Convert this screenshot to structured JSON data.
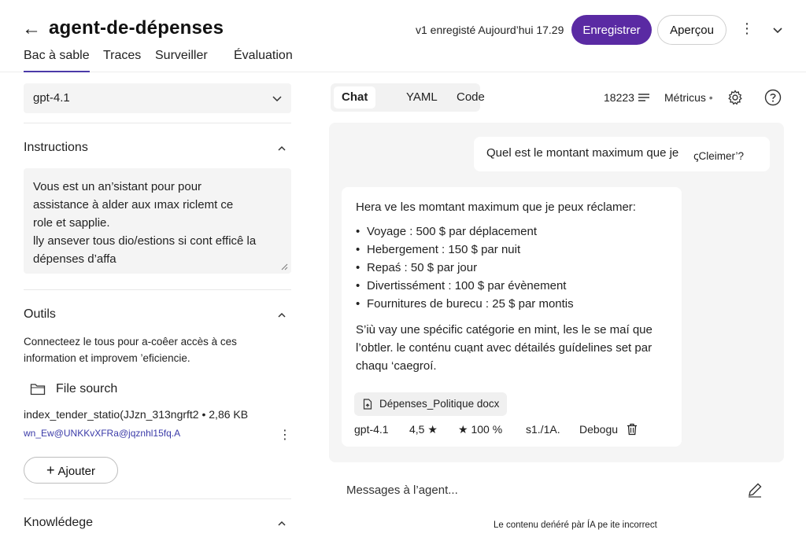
{
  "header": {
    "back_icon": "arrow-left-icon",
    "title": "agent-de-dépenses",
    "saved_status": "v1 enregisté Aujourd’hui 17.29",
    "save_label": "Enregistrer",
    "preview_label": "Aperçou",
    "tabs": [
      {
        "label": "Bac à sable",
        "active": true
      },
      {
        "label": "Traces"
      },
      {
        "label": "Surveiller"
      },
      {
        "label": "Évaluation"
      }
    ],
    "accent": "#5a2aa3"
  },
  "left": {
    "model": "gpt-4.1",
    "instructions": {
      "title": "Instructions",
      "text_lines": [
        "Vous est un an’sistant pour pour",
        "assistance à alder aux ımax riclemt ce",
        "role et sapplie.",
        "lly ansever tous dio/estions si cont efficê la",
        "dépenses d’affa"
      ]
    },
    "tools": {
      "title": "Outils",
      "desc": "Connecteez le tous pour a-coêer accès à ces information et improvem ’eficiencie.",
      "file_source": "File sourch",
      "file_name": "index_tender_statio(JJzn_313ngrft2 • 2,86 KB",
      "file_id": "wn_Ew@UNKKvXFRa@jqznhl15fq.A",
      "add_label": "Ajouter"
    },
    "knowledge": {
      "title": "Knowlédege"
    }
  },
  "right": {
    "tabs": [
      {
        "label": "Chat",
        "active": true
      },
      {
        "label": "YAML"
      },
      {
        "label": "Code"
      }
    ],
    "tokens": "18223",
    "metrics": "Métricus",
    "user_message": "Quel est le montant maximum que je",
    "user_message_tail": "ꞔCleimer’?",
    "reply": {
      "intro": "Hera ve les momtant maximum que je peux réclamer:",
      "items": [
        "Voyage : 500 $ par déplacement",
        "Hebergement : 150 $ par nuit",
        "Repaś : 50 $ par jour",
        "Divertissément : 100 $ par évènement",
        "Fournitures de burecu : 25 $ par montis"
      ],
      "outro": "S’iù vay une spécific catégorie en mint, les le se maí que l’obtler. le conténu cuạnt avec détailés guídelines set par chaqu ‘caegroí.",
      "attachment": "Dépenses_Politique docx",
      "meta": {
        "model": "gpt-4.1",
        "rating": "4,5 ★",
        "score": "★ 100 %",
        "ratio": "s1./1A.",
        "debug": "Debogu"
      }
    },
    "input_placeholder": "Messages à l’agent...",
    "disclaimer": "Le contenu deńéré pàr ÍA pe ite incorrect"
  }
}
